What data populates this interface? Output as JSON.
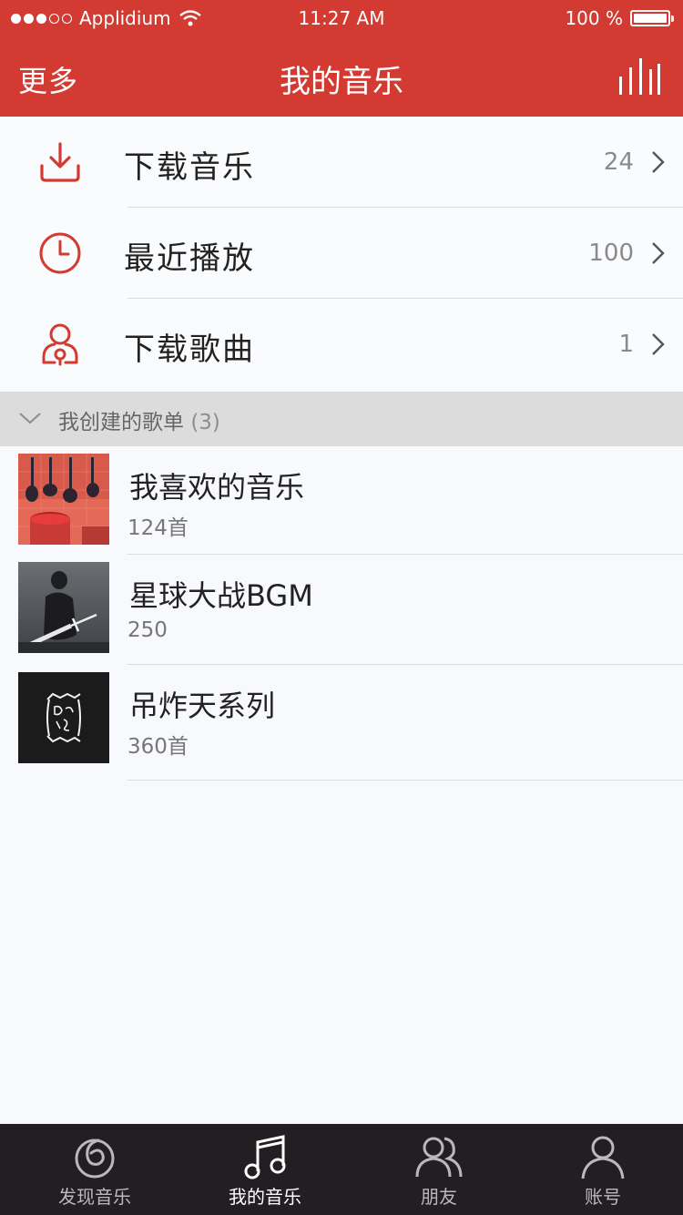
{
  "status_bar": {
    "carrier": "Applidium",
    "time": "11:27 AM",
    "battery": "100 %"
  },
  "nav": {
    "left": "更多",
    "title": "我的音乐"
  },
  "menu": [
    {
      "label": "下载音乐",
      "count": "24",
      "icon": "download-icon"
    },
    {
      "label": "最近播放",
      "count": "100",
      "icon": "clock-icon"
    },
    {
      "label": "下载歌曲",
      "count": "1",
      "icon": "person-icon"
    }
  ],
  "section": {
    "title": "我创建的歌单",
    "count": "(3)"
  },
  "playlists": [
    {
      "name": "我喜欢的音乐",
      "sub": "124首"
    },
    {
      "name": "星球大战BGM",
      "sub": "250"
    },
    {
      "name": "吊炸天系列",
      "sub": "360首"
    }
  ],
  "tabs": [
    {
      "label": "发现音乐",
      "icon": "netease-logo-icon"
    },
    {
      "label": "我的音乐",
      "icon": "music-note-icon"
    },
    {
      "label": "朋友",
      "icon": "friends-icon"
    },
    {
      "label": "账号",
      "icon": "account-icon"
    }
  ],
  "colors": {
    "accent": "#d33a31",
    "tabbar": "#221e22"
  }
}
